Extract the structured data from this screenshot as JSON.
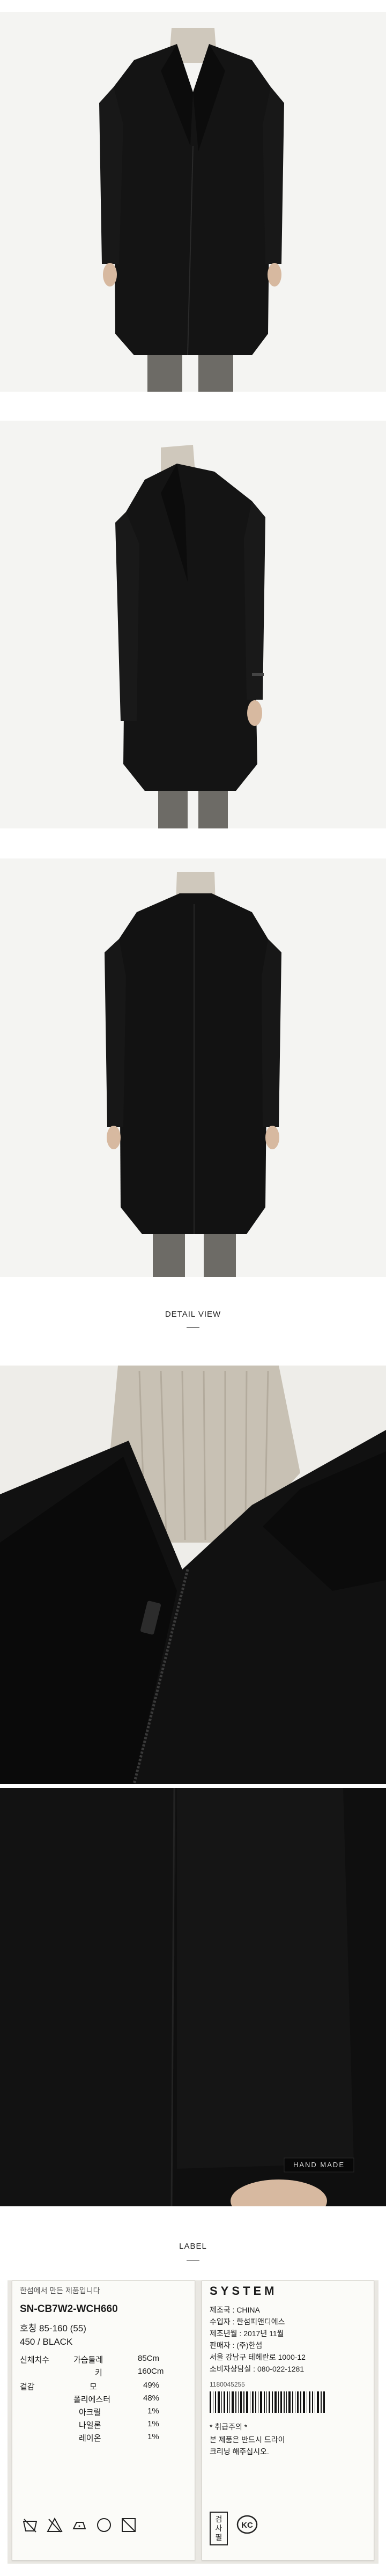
{
  "sections": {
    "detail_view_title": "DETAIL VIEW",
    "label_title": "LABEL"
  },
  "photos": {
    "front_view": "model-front-photo",
    "side_view": "model-side-photo",
    "back_view": "model-back-photo",
    "detail_collar": "collar-zipper-detail-photo",
    "detail_sleeve": "sleeve-tag-detail-photo"
  },
  "sleeve_tag_text": "HAND MADE",
  "label_left": {
    "header": "한섬에서 만든 제품입니다",
    "style_code": "SN-CB7W2-WCH660",
    "size_line": "호칭 85-160 (55)",
    "color_line": "450 / BLACK",
    "measure_title": "신체치수",
    "measure_rows": [
      {
        "name": "가슴둘레",
        "value": "85Cm"
      },
      {
        "name": "키",
        "value": "160Cm"
      }
    ],
    "material_title": "겉감",
    "materials": [
      {
        "name": "모",
        "value": "49%"
      },
      {
        "name": "폴리에스터",
        "value": "48%"
      },
      {
        "name": "아크릴",
        "value": "1%"
      },
      {
        "name": "나일론",
        "value": "1%"
      },
      {
        "name": "레이온",
        "value": "1%"
      }
    ]
  },
  "label_right": {
    "brand": "SYSTEM",
    "origin": "제조국 : CHINA",
    "importer": "수입자 : 한섬피앤디에스",
    "made_date": "제조년월 : 2017년 11월",
    "seller": "판매자 : (주)한섬",
    "address": "서울 강남구 테헤란로 1000-12",
    "phone": "소비자상담실 : 080-022-1281",
    "barcode_number": "1180045255",
    "care_title": "* 취급주의 *",
    "care_lines": [
      "본 제품은 반드시 드라이",
      "크리닝 해주십시오."
    ],
    "inspection_mark": "검사필",
    "kc_mark": "KC"
  },
  "colors": {
    "coat": "#121212",
    "background": "#f4f4f2",
    "turtleneck": "#cfc8bc",
    "pants": "#6d6b66"
  }
}
